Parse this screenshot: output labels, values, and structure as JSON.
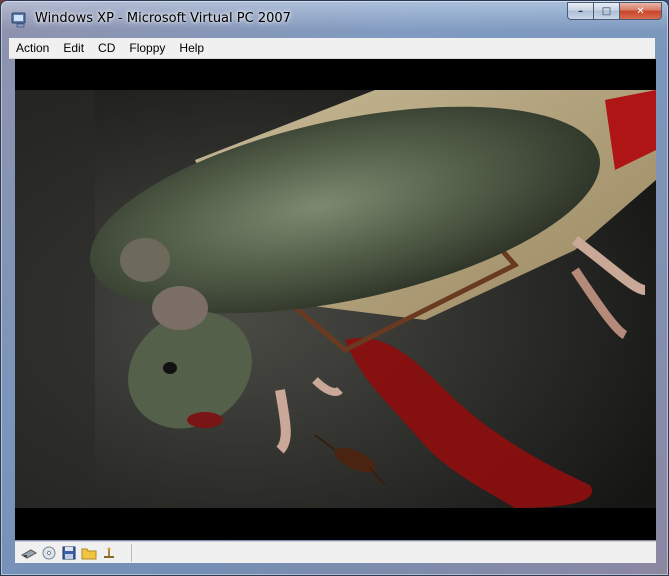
{
  "window": {
    "title": "Windows XP - Microsoft Virtual PC 2007",
    "minimize_symbol": "–",
    "maximize_symbol": "□",
    "close_symbol": "✕"
  },
  "menu": {
    "items": [
      "Action",
      "Edit",
      "CD",
      "Floppy",
      "Help"
    ]
  },
  "status_icons": [
    "network-adapter-icon",
    "cd-drive-icon",
    "floppy-disk-icon",
    "shared-folder-icon",
    "usb-icon"
  ],
  "colors": {
    "blood": "#8a0f0f",
    "letterbox": "#000000"
  }
}
